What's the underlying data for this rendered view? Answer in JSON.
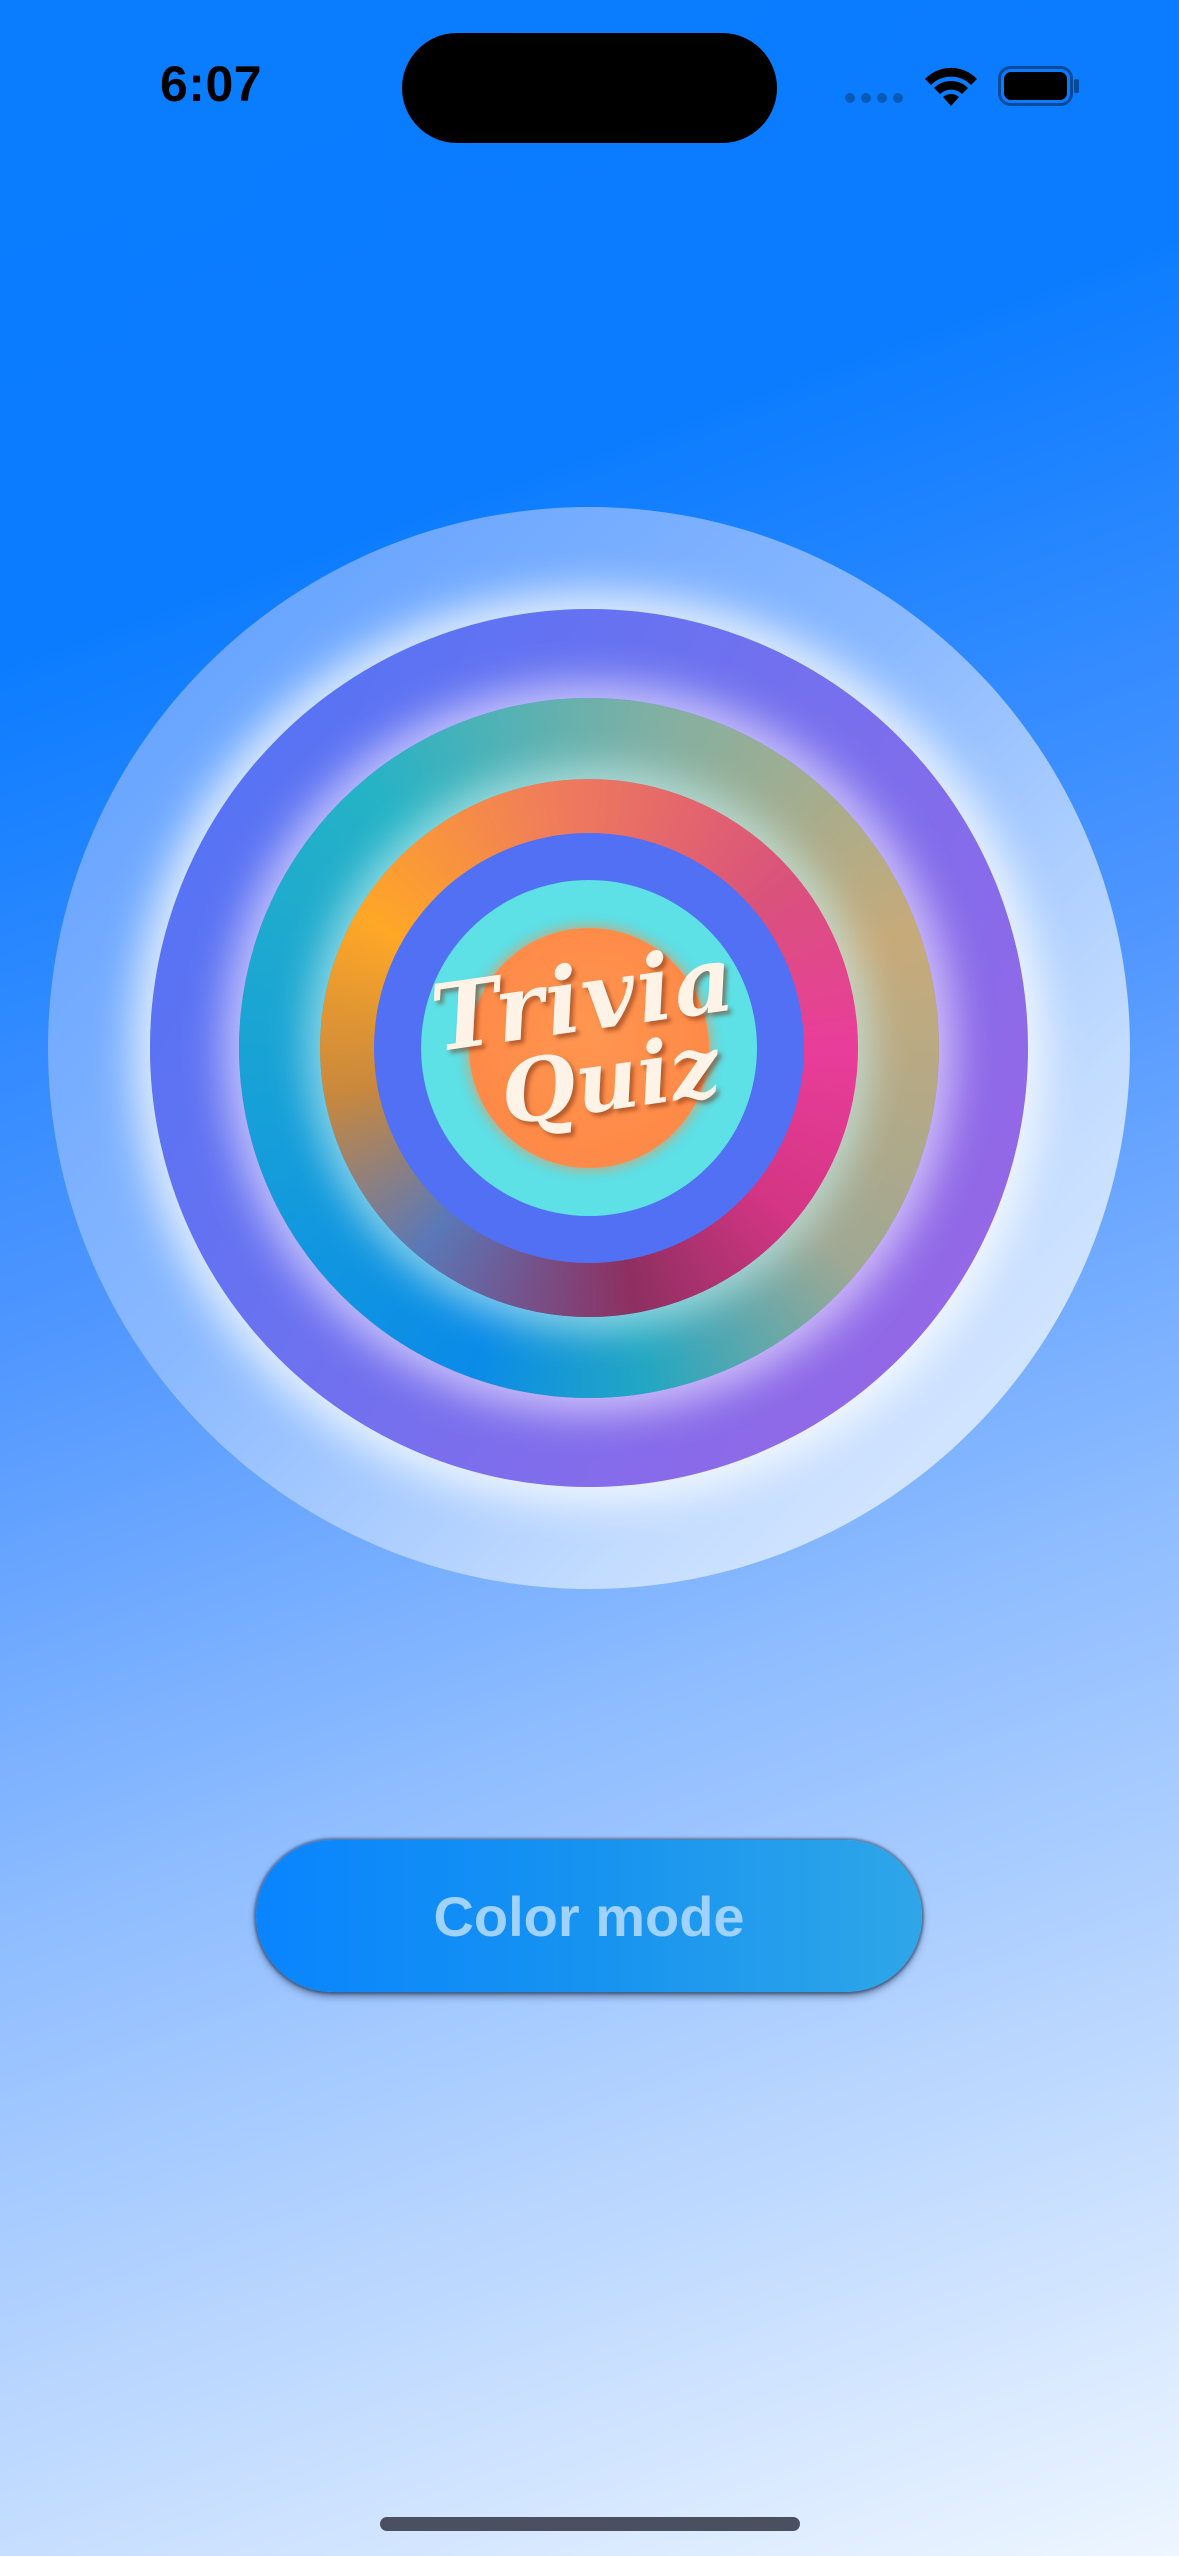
{
  "status_bar": {
    "time": "6:07",
    "icons": [
      "signal-icon",
      "wifi-icon",
      "battery-icon"
    ]
  },
  "logo": {
    "line_1": "Trivia",
    "line_2": "Quiz"
  },
  "button": {
    "label": "Color mode"
  },
  "colors": {
    "background_top": "#0b7cff",
    "background_bottom": "#eef6ff",
    "button": "#0a84ff",
    "button_text": "#9fd2ff",
    "logo_core": "#ff8a48",
    "logo_text": "#fff3e8"
  }
}
